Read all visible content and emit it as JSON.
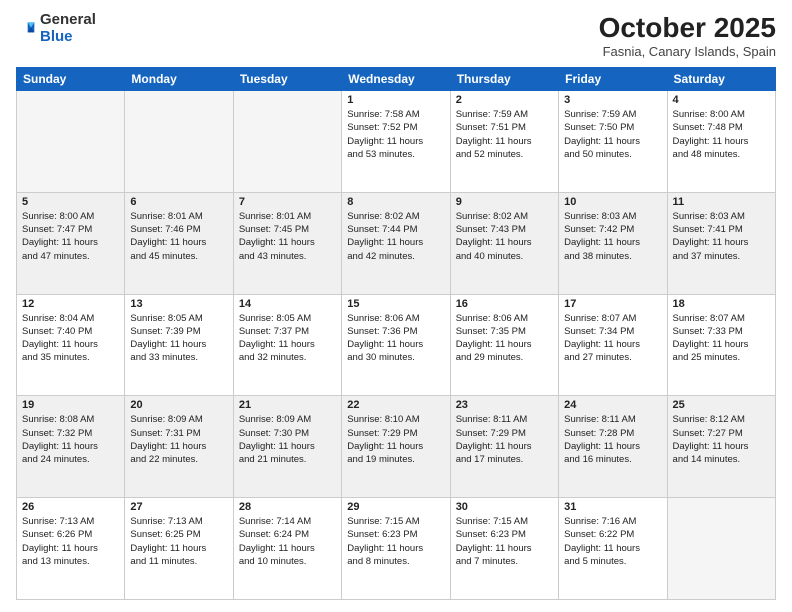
{
  "logo": {
    "general": "General",
    "blue": "Blue"
  },
  "title": "October 2025",
  "subtitle": "Fasnia, Canary Islands, Spain",
  "days_header": [
    "Sunday",
    "Monday",
    "Tuesday",
    "Wednesday",
    "Thursday",
    "Friday",
    "Saturday"
  ],
  "weeks": [
    [
      {
        "day": "",
        "info": ""
      },
      {
        "day": "",
        "info": ""
      },
      {
        "day": "",
        "info": ""
      },
      {
        "day": "1",
        "info": "Sunrise: 7:58 AM\nSunset: 7:52 PM\nDaylight: 11 hours\nand 53 minutes."
      },
      {
        "day": "2",
        "info": "Sunrise: 7:59 AM\nSunset: 7:51 PM\nDaylight: 11 hours\nand 52 minutes."
      },
      {
        "day": "3",
        "info": "Sunrise: 7:59 AM\nSunset: 7:50 PM\nDaylight: 11 hours\nand 50 minutes."
      },
      {
        "day": "4",
        "info": "Sunrise: 8:00 AM\nSunset: 7:48 PM\nDaylight: 11 hours\nand 48 minutes."
      }
    ],
    [
      {
        "day": "5",
        "info": "Sunrise: 8:00 AM\nSunset: 7:47 PM\nDaylight: 11 hours\nand 47 minutes."
      },
      {
        "day": "6",
        "info": "Sunrise: 8:01 AM\nSunset: 7:46 PM\nDaylight: 11 hours\nand 45 minutes."
      },
      {
        "day": "7",
        "info": "Sunrise: 8:01 AM\nSunset: 7:45 PM\nDaylight: 11 hours\nand 43 minutes."
      },
      {
        "day": "8",
        "info": "Sunrise: 8:02 AM\nSunset: 7:44 PM\nDaylight: 11 hours\nand 42 minutes."
      },
      {
        "day": "9",
        "info": "Sunrise: 8:02 AM\nSunset: 7:43 PM\nDaylight: 11 hours\nand 40 minutes."
      },
      {
        "day": "10",
        "info": "Sunrise: 8:03 AM\nSunset: 7:42 PM\nDaylight: 11 hours\nand 38 minutes."
      },
      {
        "day": "11",
        "info": "Sunrise: 8:03 AM\nSunset: 7:41 PM\nDaylight: 11 hours\nand 37 minutes."
      }
    ],
    [
      {
        "day": "12",
        "info": "Sunrise: 8:04 AM\nSunset: 7:40 PM\nDaylight: 11 hours\nand 35 minutes."
      },
      {
        "day": "13",
        "info": "Sunrise: 8:05 AM\nSunset: 7:39 PM\nDaylight: 11 hours\nand 33 minutes."
      },
      {
        "day": "14",
        "info": "Sunrise: 8:05 AM\nSunset: 7:37 PM\nDaylight: 11 hours\nand 32 minutes."
      },
      {
        "day": "15",
        "info": "Sunrise: 8:06 AM\nSunset: 7:36 PM\nDaylight: 11 hours\nand 30 minutes."
      },
      {
        "day": "16",
        "info": "Sunrise: 8:06 AM\nSunset: 7:35 PM\nDaylight: 11 hours\nand 29 minutes."
      },
      {
        "day": "17",
        "info": "Sunrise: 8:07 AM\nSunset: 7:34 PM\nDaylight: 11 hours\nand 27 minutes."
      },
      {
        "day": "18",
        "info": "Sunrise: 8:07 AM\nSunset: 7:33 PM\nDaylight: 11 hours\nand 25 minutes."
      }
    ],
    [
      {
        "day": "19",
        "info": "Sunrise: 8:08 AM\nSunset: 7:32 PM\nDaylight: 11 hours\nand 24 minutes."
      },
      {
        "day": "20",
        "info": "Sunrise: 8:09 AM\nSunset: 7:31 PM\nDaylight: 11 hours\nand 22 minutes."
      },
      {
        "day": "21",
        "info": "Sunrise: 8:09 AM\nSunset: 7:30 PM\nDaylight: 11 hours\nand 21 minutes."
      },
      {
        "day": "22",
        "info": "Sunrise: 8:10 AM\nSunset: 7:29 PM\nDaylight: 11 hours\nand 19 minutes."
      },
      {
        "day": "23",
        "info": "Sunrise: 8:11 AM\nSunset: 7:29 PM\nDaylight: 11 hours\nand 17 minutes."
      },
      {
        "day": "24",
        "info": "Sunrise: 8:11 AM\nSunset: 7:28 PM\nDaylight: 11 hours\nand 16 minutes."
      },
      {
        "day": "25",
        "info": "Sunrise: 8:12 AM\nSunset: 7:27 PM\nDaylight: 11 hours\nand 14 minutes."
      }
    ],
    [
      {
        "day": "26",
        "info": "Sunrise: 7:13 AM\nSunset: 6:26 PM\nDaylight: 11 hours\nand 13 minutes."
      },
      {
        "day": "27",
        "info": "Sunrise: 7:13 AM\nSunset: 6:25 PM\nDaylight: 11 hours\nand 11 minutes."
      },
      {
        "day": "28",
        "info": "Sunrise: 7:14 AM\nSunset: 6:24 PM\nDaylight: 11 hours\nand 10 minutes."
      },
      {
        "day": "29",
        "info": "Sunrise: 7:15 AM\nSunset: 6:23 PM\nDaylight: 11 hours\nand 8 minutes."
      },
      {
        "day": "30",
        "info": "Sunrise: 7:15 AM\nSunset: 6:23 PM\nDaylight: 11 hours\nand 7 minutes."
      },
      {
        "day": "31",
        "info": "Sunrise: 7:16 AM\nSunset: 6:22 PM\nDaylight: 11 hours\nand 5 minutes."
      },
      {
        "day": "",
        "info": ""
      }
    ]
  ]
}
